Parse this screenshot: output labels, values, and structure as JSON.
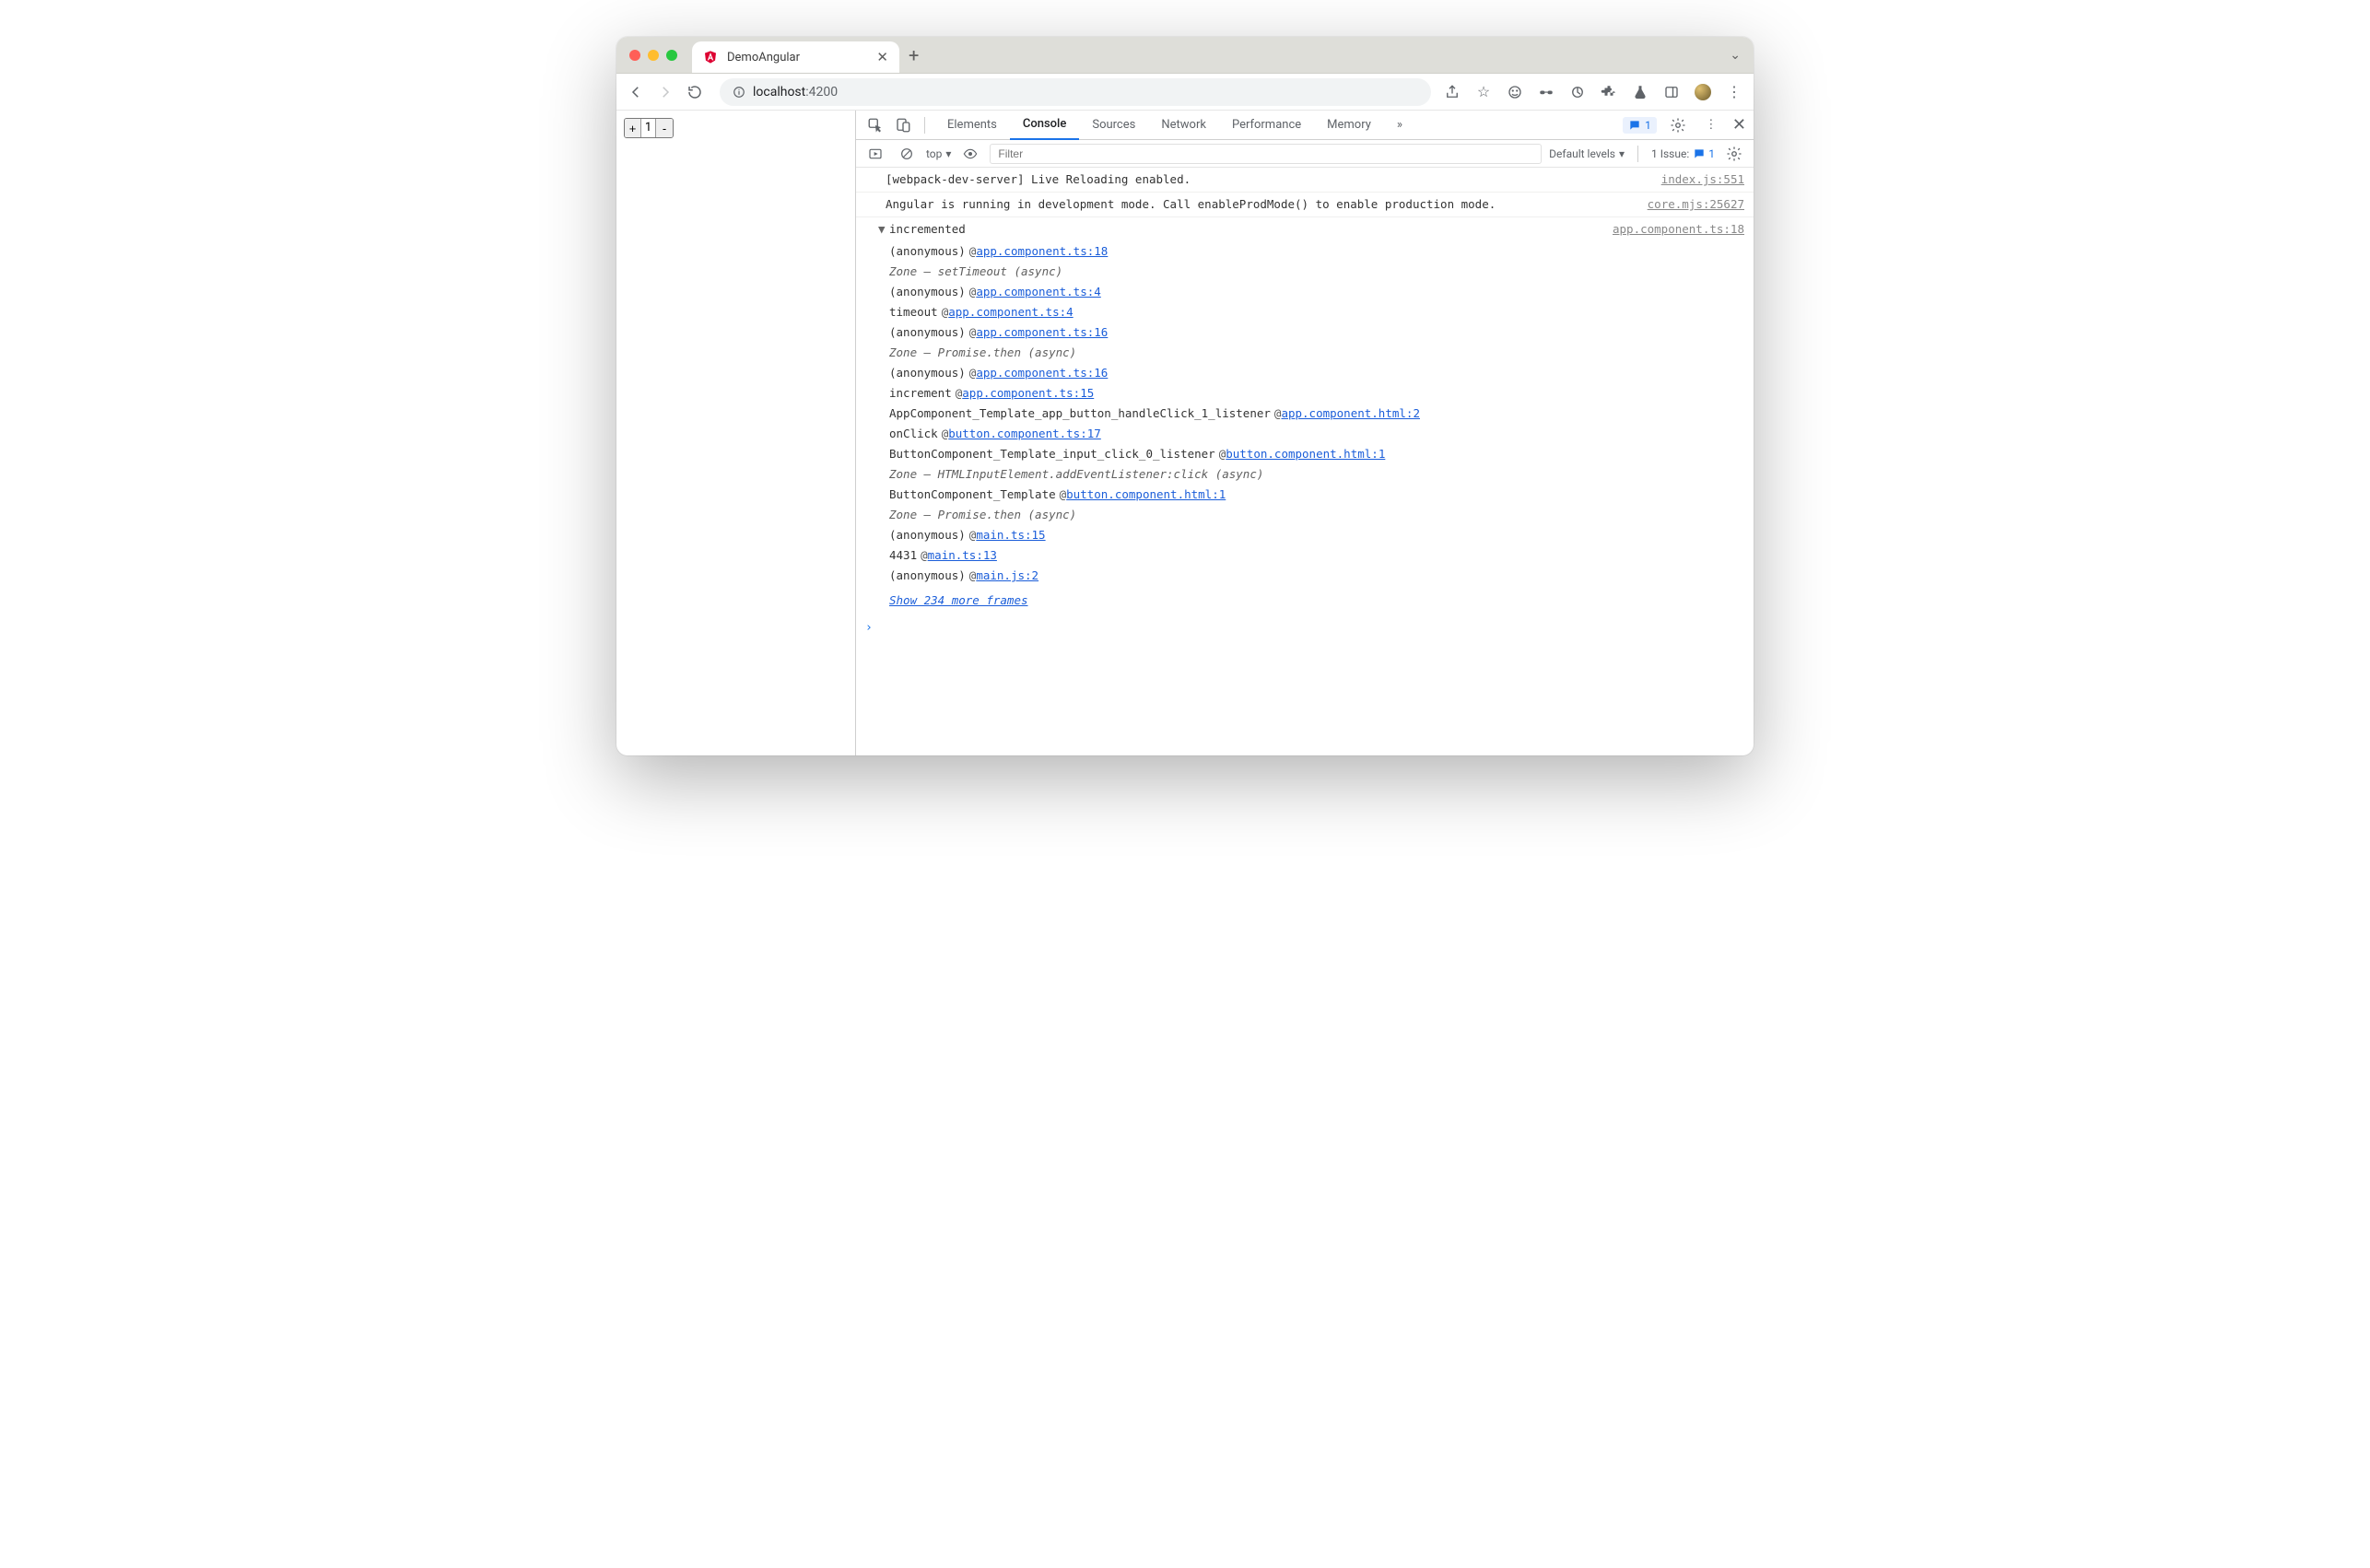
{
  "tab": {
    "title": "DemoAngular"
  },
  "omnibox": {
    "host": "localhost",
    "port": ":4200"
  },
  "page": {
    "counter_value": "1",
    "plus_label": "+",
    "minus_label": "-"
  },
  "devtools": {
    "tabs": [
      "Elements",
      "Console",
      "Sources",
      "Network",
      "Performance",
      "Memory"
    ],
    "active_tab": "Console",
    "messages_badge": "1",
    "filterbar": {
      "context": "top",
      "filter_placeholder": "Filter",
      "levels": "Default levels",
      "issues_label": "1 Issue:",
      "issues_count": "1"
    },
    "logs": [
      {
        "text": "[webpack-dev-server] Live Reloading enabled.",
        "src": "index.js:551"
      },
      {
        "text": "Angular is running in development mode. Call enableProdMode() to enable production mode.",
        "src": "core.mjs:25627"
      }
    ],
    "trace": {
      "label": "incremented",
      "src": "app.component.ts:18",
      "show_more": "Show 234 more frames",
      "frames": [
        {
          "fn": "(anonymous)",
          "link": "app.component.ts:18"
        },
        {
          "fn": "Zone – setTimeout (async)",
          "zone": true
        },
        {
          "fn": "(anonymous)",
          "link": "app.component.ts:4"
        },
        {
          "fn": "timeout",
          "link": "app.component.ts:4"
        },
        {
          "fn": "(anonymous)",
          "link": "app.component.ts:16"
        },
        {
          "fn": "Zone – Promise.then (async)",
          "zone": true
        },
        {
          "fn": "(anonymous)",
          "link": "app.component.ts:16"
        },
        {
          "fn": "increment",
          "link": "app.component.ts:15"
        },
        {
          "fn": "AppComponent_Template_app_button_handleClick_1_listener",
          "link": "app.component.html:2"
        },
        {
          "fn": "onClick",
          "link": "button.component.ts:17"
        },
        {
          "fn": "ButtonComponent_Template_input_click_0_listener",
          "link": "button.component.html:1"
        },
        {
          "fn": "Zone – HTMLInputElement.addEventListener:click (async)",
          "zone": true
        },
        {
          "fn": "ButtonComponent_Template",
          "link": "button.component.html:1"
        },
        {
          "fn": "Zone – Promise.then (async)",
          "zone": true
        },
        {
          "fn": "(anonymous)",
          "link": "main.ts:15"
        },
        {
          "fn": "4431",
          "link": "main.ts:13"
        },
        {
          "fn": "(anonymous)",
          "link": "main.js:2"
        }
      ]
    }
  }
}
